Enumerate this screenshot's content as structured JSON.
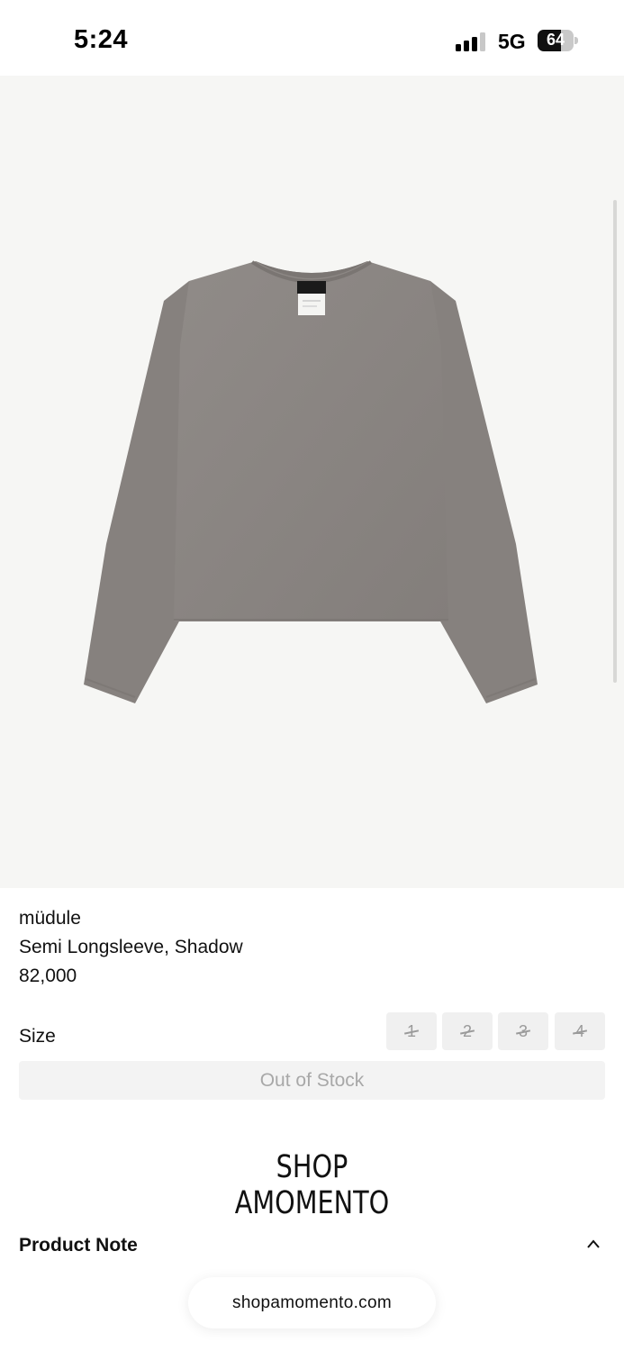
{
  "status_bar": {
    "time": "5:24",
    "network": "5G",
    "battery_percent": "64",
    "battery_level": 0.64
  },
  "product": {
    "brand": "müdule",
    "name": "Semi Longsleeve, Shadow",
    "price": "82,000",
    "image_icon": "shirt-photo",
    "image_color": "#8b8683"
  },
  "size": {
    "label": "Size",
    "options": [
      {
        "label": "1",
        "available": false
      },
      {
        "label": "2",
        "available": false
      },
      {
        "label": "3",
        "available": false
      },
      {
        "label": "4",
        "available": false
      }
    ]
  },
  "stock_button": "Out of Stock",
  "store_logo": {
    "line1": "SHOP",
    "line2": "AMOMENTO"
  },
  "product_note": {
    "label": "Product Note",
    "icon": "chevron-up-icon"
  },
  "browser": {
    "url": "shopamomento.com"
  }
}
